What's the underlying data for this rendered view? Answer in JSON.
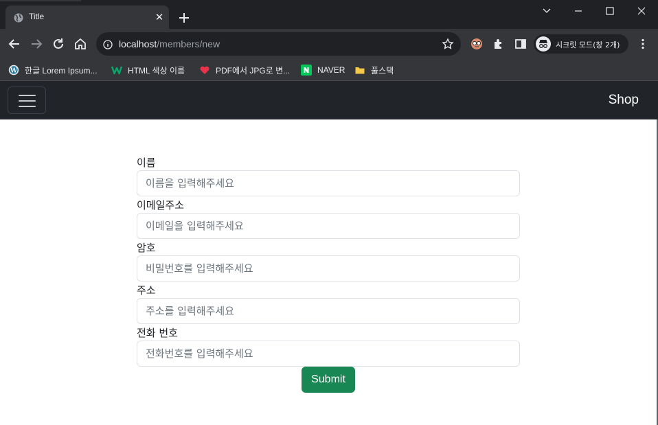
{
  "browser": {
    "tab": {
      "title": "Title"
    },
    "url": {
      "host": "localhost",
      "path": "/members/new"
    },
    "profile": {
      "label": "시크릿 모드(창 2개)"
    },
    "bookmarks": [
      {
        "label": "한글 Lorem Ipsum...",
        "icon": "wordpress-icon"
      },
      {
        "label": "HTML 색상 이름",
        "icon": "w-logo-icon"
      },
      {
        "label": "PDF에서 JPG로 변...",
        "icon": "heart-icon"
      },
      {
        "label": "NAVER",
        "icon": "naver-icon"
      },
      {
        "label": "풀스택",
        "icon": "folder-icon"
      }
    ],
    "colors": {
      "titlebar": "#202124",
      "toolbar": "#35363a"
    }
  },
  "navbar": {
    "brand": "Shop",
    "color": "#212529"
  },
  "form": {
    "fields": [
      {
        "label": "이름",
        "placeholder": "이름을 입력해주세요"
      },
      {
        "label": "이메일주소",
        "placeholder": "이메일을 입력해주세요"
      },
      {
        "label": "암호",
        "placeholder": "비밀번호를 입력해주세요"
      },
      {
        "label": "주소",
        "placeholder": "주소를 입력해주세요"
      },
      {
        "label": "전화 번호",
        "placeholder": "전화번호를 입력해주세요"
      }
    ],
    "submit_label": "Submit",
    "submit_color": "#198754"
  }
}
